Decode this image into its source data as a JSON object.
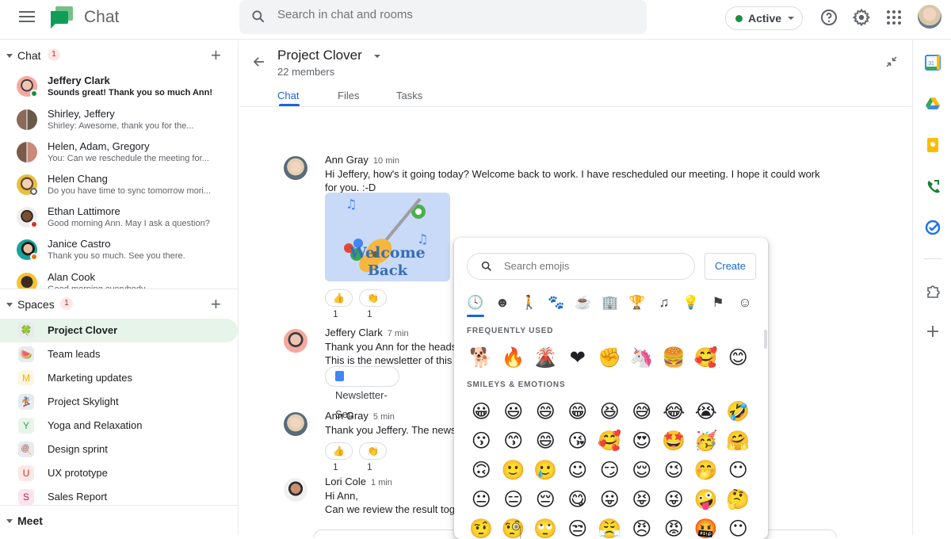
{
  "topbar": {
    "app_title": "Chat",
    "search_placeholder": "Search in chat and rooms",
    "status": "Active",
    "icons": [
      "menu-icon",
      "help-icon",
      "settings-icon",
      "apps-grid-icon",
      "account-avatar"
    ]
  },
  "sidebar": {
    "chat_section": {
      "title": "Chat",
      "badge": "1",
      "items": [
        {
          "name": "Jeffery Clark",
          "preview": "Sounds great! Thank you so much Ann!",
          "unread": true,
          "status": "online",
          "status_color": "#1e8e3e"
        },
        {
          "name": "Shirley, Jeffery",
          "preview": "Shirley: Awesome, thank you for the...",
          "unread": false,
          "status": "group"
        },
        {
          "name": "Helen, Adam, Gregory",
          "preview": "You: Can we reschedule the meeting for...",
          "unread": false,
          "status": "group"
        },
        {
          "name": "Helen Chang",
          "preview": "Do you have time to sync tomorrow mori...",
          "unread": false,
          "status": "away"
        },
        {
          "name": "Ethan Lattimore",
          "preview": "Good morning Ann. May I ask a question?",
          "unread": false,
          "status": "do-not-disturb",
          "status_color": "#d93025"
        },
        {
          "name": "Janice Castro",
          "preview": "Thank you so much. See you there.",
          "unread": false,
          "status": "out-of-office",
          "status_color": "#e37400"
        },
        {
          "name": "Alan Cook",
          "preview": "Good morning everybody",
          "unread": false,
          "status": "none"
        }
      ]
    },
    "spaces_section": {
      "title": "Spaces",
      "badge": "1",
      "items": [
        {
          "name": "Project Clover",
          "icon": "🍀",
          "active": true
        },
        {
          "name": "Team leads",
          "icon": "🍉",
          "active": false
        },
        {
          "name": "Marketing updates",
          "icon": "M",
          "active": false
        },
        {
          "name": "Project Skylight",
          "icon": "🏂",
          "active": false
        },
        {
          "name": "Yoga and Relaxation",
          "icon": "Y",
          "active": false
        },
        {
          "name": "Design sprint",
          "icon": "🍭",
          "active": false
        },
        {
          "name": "UX prototype",
          "icon": "U",
          "active": false
        },
        {
          "name": "Sales Report",
          "icon": "S",
          "active": false
        }
      ]
    },
    "meet_section": {
      "title": "Meet"
    }
  },
  "room": {
    "title": "Project Clover",
    "members": "22 members",
    "tabs": [
      {
        "label": "Chat",
        "active": true
      },
      {
        "label": "Files",
        "active": false
      },
      {
        "label": "Tasks",
        "active": false
      }
    ],
    "messages": [
      {
        "sender": "Ann Gray",
        "time": "10 min",
        "text": "Hi Jeffery, how's it going today? Welcome back to work. I have rescheduled our meeting. I hope it could work\nfor you. :-D",
        "image_text": [
          "Welcome",
          "Back"
        ],
        "reactions": [
          {
            "emoji": "👍",
            "count": "1"
          },
          {
            "emoji": "👏",
            "count": "1"
          }
        ]
      },
      {
        "sender": "Jeffery Clark",
        "time": "7 min",
        "text": "Thank you Ann for the heads up.\nThis is the newsletter of this month.",
        "attachment": "Newsletter-Sep"
      },
      {
        "sender": "Ann Gray",
        "time": "5 min",
        "text": "Thank you Jeffery. The newsletter looks great.",
        "reactions": [
          {
            "emoji": "👍",
            "count": "1"
          },
          {
            "emoji": "👏",
            "count": "1"
          }
        ]
      },
      {
        "sender": "Lori Cole",
        "time": "1 min",
        "text": "Hi Ann,\nCan we review the result together?"
      }
    ]
  },
  "emoji_picker": {
    "search_placeholder": "Search emojis",
    "create_label": "Create",
    "categories": [
      "🕓",
      "☻",
      "🚶",
      "🐾",
      "☕",
      "🏢",
      "🏆",
      "♫",
      "💡",
      "⚑",
      "☺"
    ],
    "category_names": [
      "recent",
      "smileys",
      "people",
      "animals",
      "food",
      "travel",
      "activities",
      "symbols",
      "objects",
      "flags",
      "custom"
    ],
    "frequently_used_label": "FREQUENTLY USED",
    "frequently_used": [
      "🐕",
      "🔥",
      "🌋",
      "❤",
      "✊",
      "🦄",
      "🍔",
      "🥰",
      "😊"
    ],
    "smileys_label": "SMILEYS & EMOTIONS",
    "smileys": [
      "😀",
      "😃",
      "😄",
      "😁",
      "😆",
      "😅",
      "😂",
      "😭",
      "🤣",
      "😗",
      "😙",
      "😄",
      "😘",
      "🥰",
      "😍",
      "🤩",
      "🥳",
      "🤗",
      "🙃",
      "🙂",
      "🥲",
      "☺",
      "😏",
      "😌",
      "😉",
      "🤭",
      "😶",
      "😐",
      "😑",
      "😔",
      "😋",
      "😛",
      "😝",
      "😜",
      "🤪",
      "🤔",
      "🤨",
      "🧐",
      "🙄",
      "😒",
      "😤",
      "😠",
      "😡",
      "🤬",
      "😶"
    ]
  },
  "right_rail": {
    "apps": [
      "calendar",
      "drive",
      "keep",
      "voice",
      "tasks",
      "add-ons",
      "add-app"
    ]
  }
}
